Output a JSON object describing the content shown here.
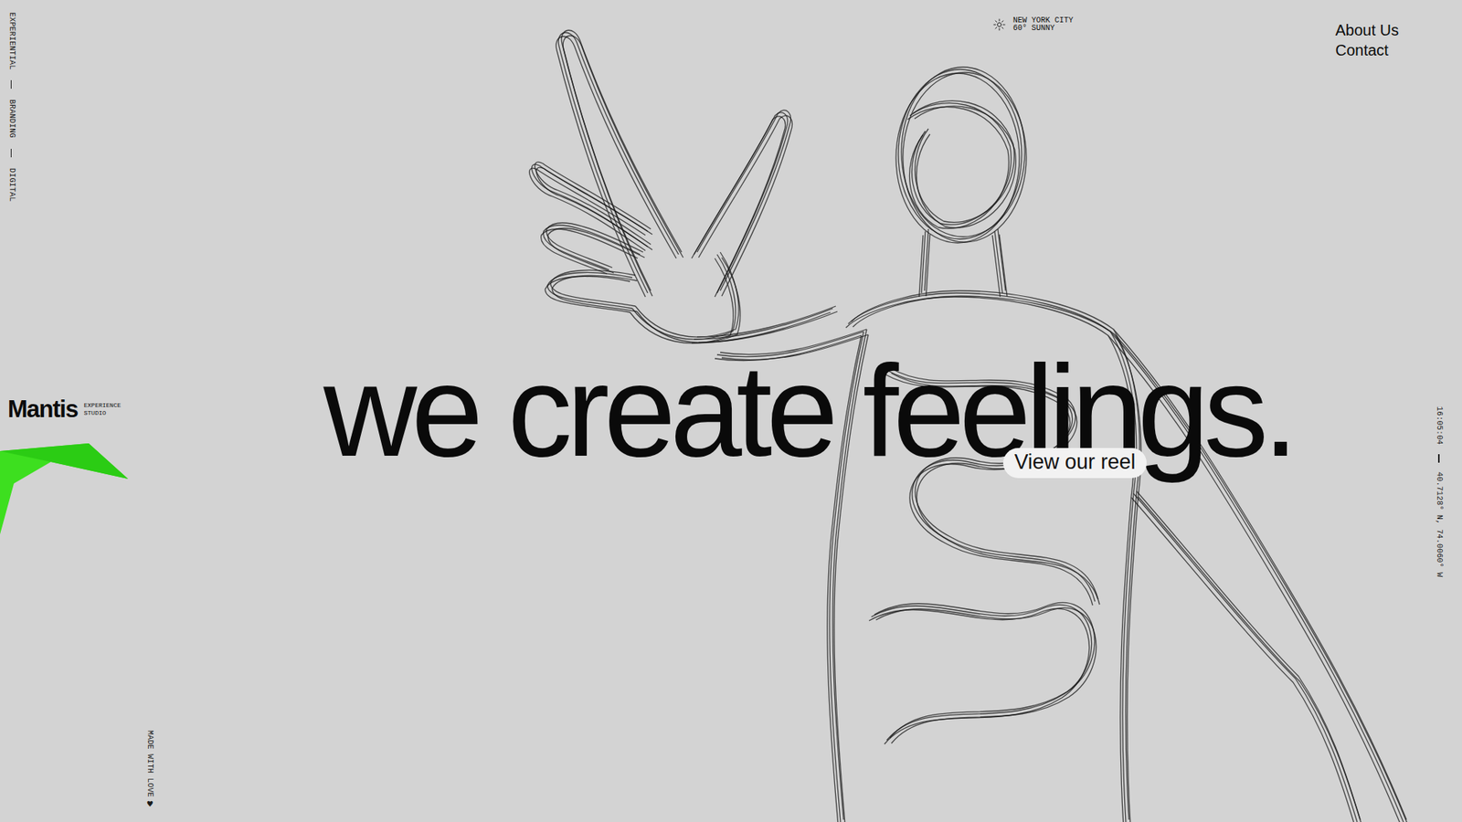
{
  "rail_tags": [
    "EXPERIENTIAL",
    "BRANDING",
    "DIGITAL"
  ],
  "weather": {
    "city": "NEW YORK CITY",
    "condition": "60° SUNNY"
  },
  "nav": [
    {
      "label": "About Us"
    },
    {
      "label": "Contact"
    }
  ],
  "logo": {
    "name": "Mantis",
    "tagline": [
      "EXPERIENCE",
      "STUDIO"
    ]
  },
  "headline": "we create feelings.",
  "cta": "View our reel",
  "status": {
    "time": "16:05:04",
    "coordinates": "40.7128° N, 74.0060° W"
  },
  "footer": {
    "note": "MADE WITH LOVE",
    "icon": "♥"
  }
}
